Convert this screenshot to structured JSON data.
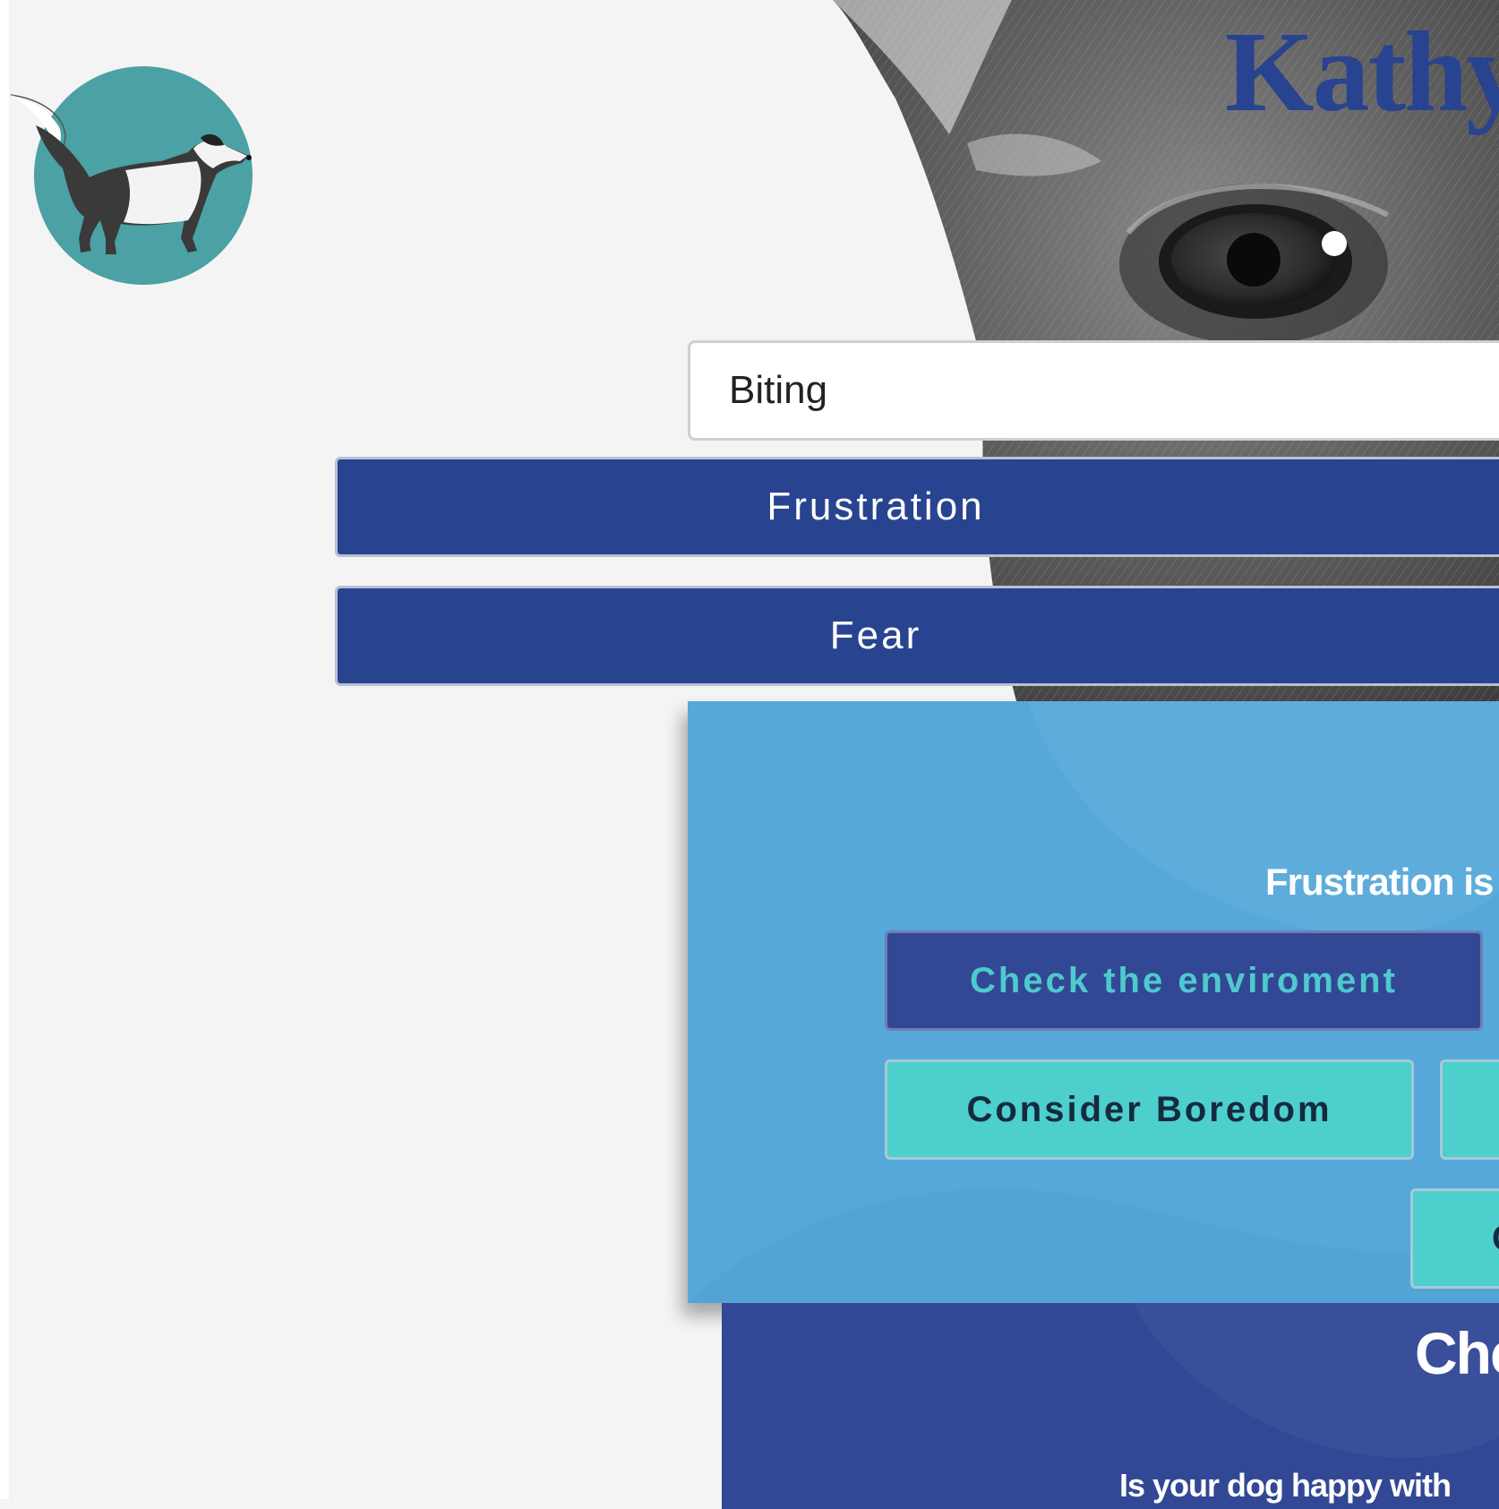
{
  "brand": {
    "title": "Kathy",
    "colors": {
      "primary": "#28438f",
      "sky": "#56a8db",
      "teal": "#4ccfcd",
      "logo_circle": "#4ba1a4"
    }
  },
  "search": {
    "value": "Biting",
    "placeholder": ""
  },
  "causes": [
    {
      "label": "Frustration"
    },
    {
      "label": "Fear"
    }
  ],
  "info_panel": {
    "text": "Frustration is",
    "actions": [
      {
        "label": "Check the enviroment",
        "style": "dark"
      },
      {
        "label": "Consider Boredom",
        "style": "teal"
      },
      {
        "label": "",
        "style": "teal"
      },
      {
        "label": "C",
        "style": "teal"
      }
    ]
  },
  "next_panel": {
    "heading": "Che",
    "question": "Is your dog happy with"
  },
  "icons": {
    "logo": "dog-walking-logo-icon",
    "hero": "dog-face-photo"
  }
}
